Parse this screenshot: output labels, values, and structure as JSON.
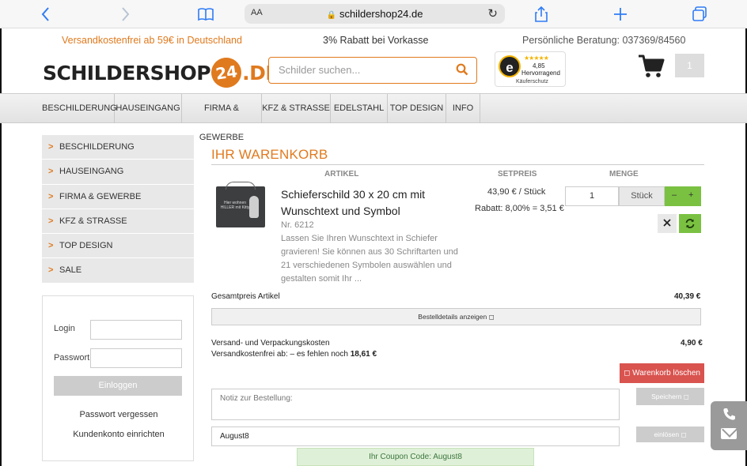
{
  "browser": {
    "text_size_label": "AA",
    "url": "schildershop24.de"
  },
  "infobar": {
    "shipping": "Versandkostenfrei ab 59€ in Deutschland",
    "discount": "3% Rabatt bei Vorkasse",
    "phone": "Persönliche Beratung: 037369/84560"
  },
  "header": {
    "logo_part1": "SCHILDER",
    "logo_part2": "SHOP",
    "logo_24": "24",
    "logo_tld": ".DE",
    "search_placeholder": "Schilder suchen...",
    "trusted_letter": "e",
    "trusted_stars": "★★★★★",
    "trusted_score": "4,85",
    "trusted_label": "Hervorragend",
    "trusted_sub": "Käuferschutz",
    "cart_count": "1"
  },
  "nav": {
    "items": [
      {
        "label": "BESCHILDERUNG"
      },
      {
        "label": "HAUSEINGANG"
      },
      {
        "label": "FIRMA & GEWERBE"
      },
      {
        "label": "KFZ & STRASSE"
      },
      {
        "label": "EDELSTAHL"
      },
      {
        "label": "TOP DESIGN"
      },
      {
        "label": "INFO"
      }
    ]
  },
  "sidebar": {
    "items": [
      {
        "label": "BESCHILDERUNG"
      },
      {
        "label": "HAUSEINGANG"
      },
      {
        "label": "FIRMA & GEWERBE"
      },
      {
        "label": "KFZ & STRASSE"
      },
      {
        "label": "TOP DESIGN"
      },
      {
        "label": "SALE"
      }
    ],
    "login": {
      "login_label": "Login",
      "password_label": "Passwort",
      "submit_label": "Einloggen",
      "forgot_link": "Passwort vergessen",
      "register_link": "Kundenkonto einrichten"
    }
  },
  "cart": {
    "title": "IHR WARENKORB",
    "columns": {
      "article": "ARTIKEL",
      "price": "SETPREIS",
      "quantity": "MENGE"
    },
    "item": {
      "image_text": "Hier wohnen HILLER mit Kitty",
      "name": "Schieferschild 30 x 20 cm mit Wunschtext und Symbol",
      "number": "Nr. 6212",
      "description": "Lassen Sie Ihren Wunschtext in Schiefer gravieren! Sie können aus 30 Schriftarten und 21 verschiedenen Symbolen auswählen und gestalten somit Ihr ...",
      "set_price": "43,90 € / Stück",
      "discount": "Rabatt: 8,00% = 3,51 €",
      "quantity": "1",
      "unit": "Stück",
      "minus": "–",
      "plus": "+"
    },
    "total_label": "Gesamtpreis Artikel",
    "total_value": "40,39 €",
    "details_button": "Bestelldetails anzeigen",
    "shipping_label": "Versand- und Verpackungskosten",
    "shipping_value": "4,90 €",
    "free_shipping_text": "Versandkostenfrei ab: – es fehlen noch",
    "free_shipping_amount": "18,61 €",
    "clear_button": "Warenkorb löschen",
    "note_placeholder": "Notiz zur Bestellung:",
    "save_button": "Speichern",
    "coupon_value": "August8",
    "redeem_button": "einlösen",
    "coupon_message": "Ihr Coupon Code: August8"
  },
  "colors": {
    "accent": "#e07a1e",
    "green": "#7ac142",
    "danger": "#d9534f"
  }
}
